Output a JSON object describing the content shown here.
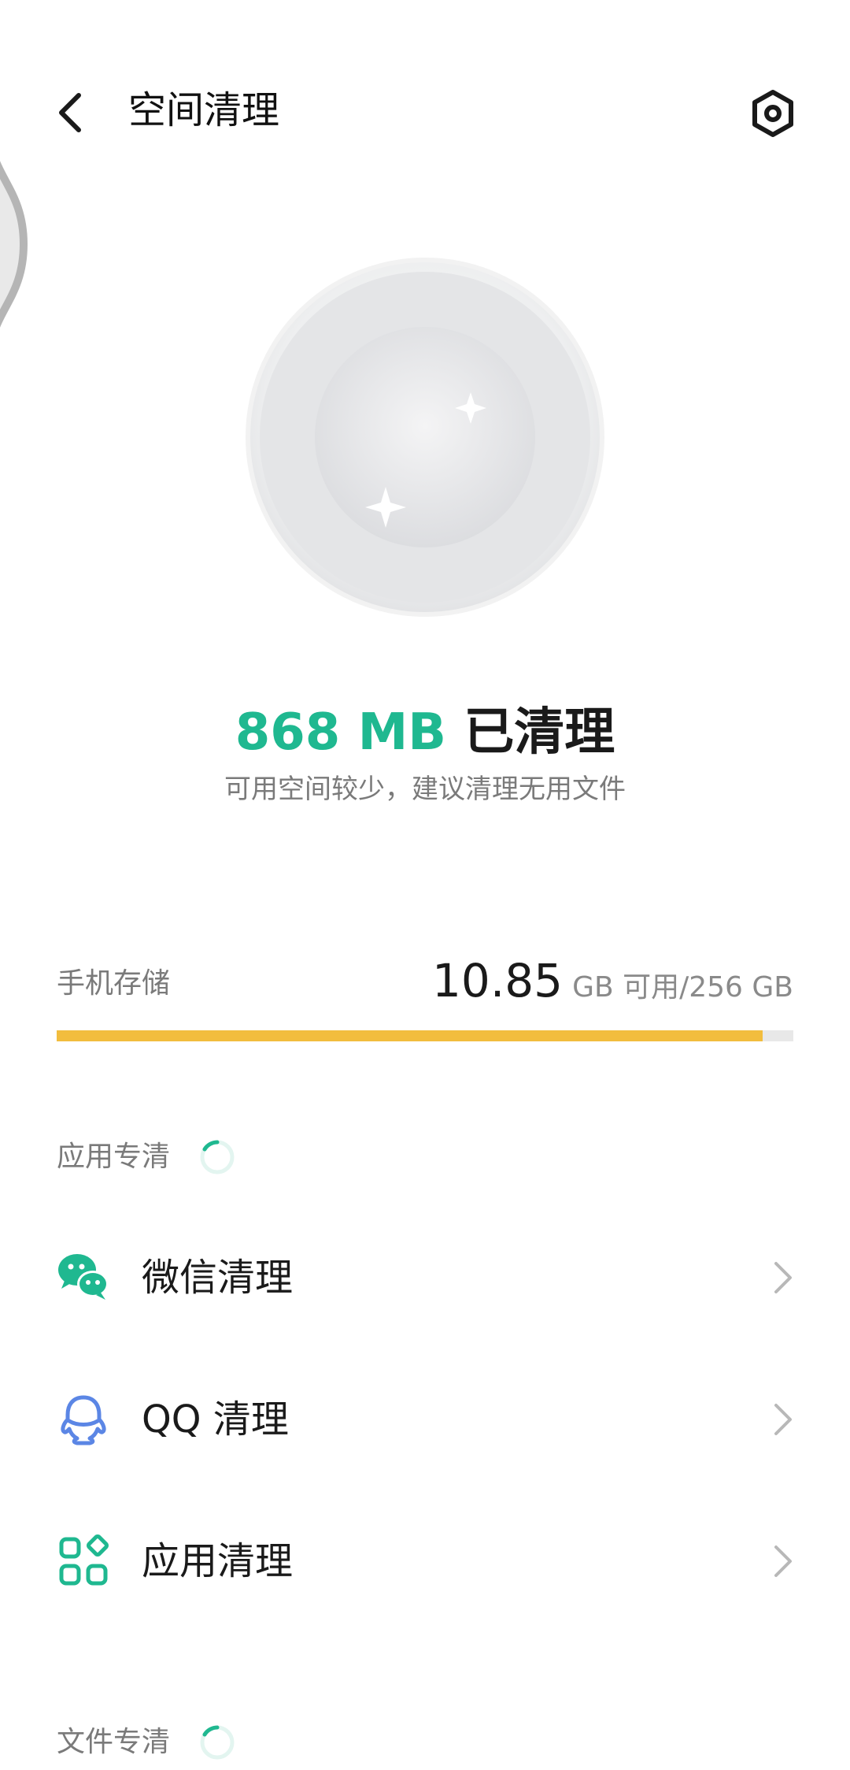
{
  "header": {
    "title": "空间清理",
    "back_icon": "chevron-left-icon",
    "settings_icon": "gear-icon"
  },
  "result": {
    "cleaned_value": "868 MB",
    "cleaned_label": "已清理",
    "subtitle": "可用空间较少，建议清理无用文件",
    "accent_color": "#1fb890"
  },
  "storage": {
    "label": "手机存储",
    "available": "10.85",
    "unit_text": "GB 可用/256 GB",
    "used_fraction": 0.958,
    "bar_color": "#f2bd3e"
  },
  "sections": {
    "apps_header": "应用专清",
    "files_header": "文件专清"
  },
  "items": [
    {
      "label": "微信清理",
      "icon": "wechat-icon"
    },
    {
      "label": "QQ 清理",
      "icon": "qq-icon"
    },
    {
      "label": "应用清理",
      "icon": "apps-grid-icon"
    }
  ]
}
